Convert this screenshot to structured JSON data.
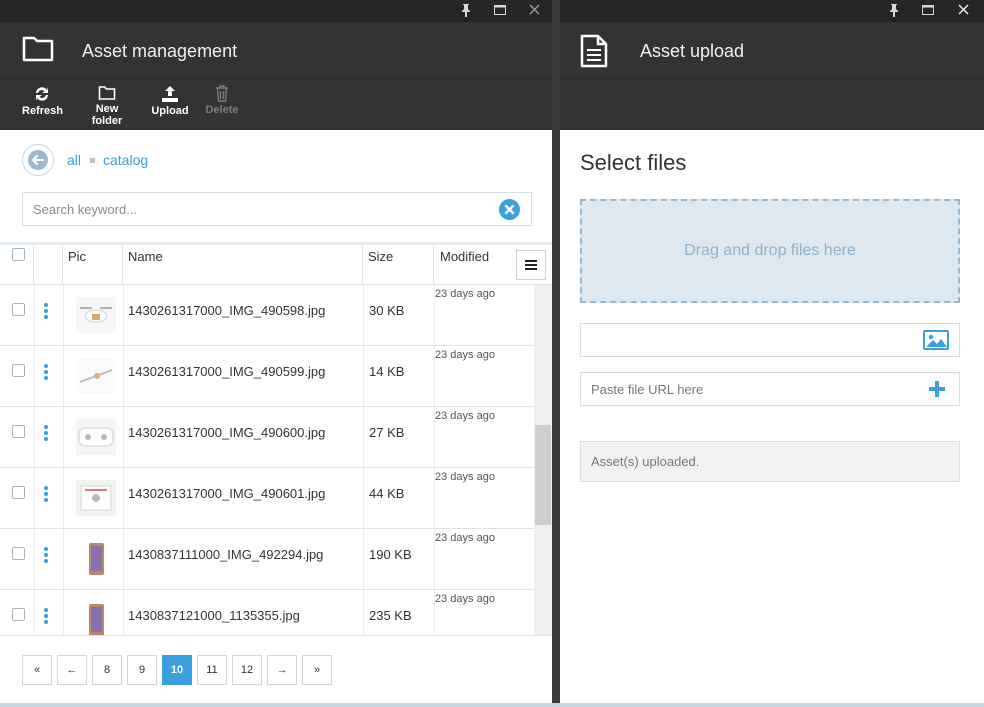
{
  "left_panel": {
    "title": "Asset management",
    "toolbar": {
      "refresh": "Refresh",
      "new_folder": "New folder",
      "upload": "Upload",
      "delete": "Delete"
    },
    "breadcrumb": [
      "all",
      "catalog"
    ],
    "search": {
      "placeholder": "Search keyword..."
    },
    "columns": [
      "Pic",
      "Name",
      "Size",
      "Modified"
    ],
    "rows": [
      {
        "name": "1430261317000_IMG_490598.jpg",
        "size": "30 KB",
        "modified": "23 days ago",
        "thumb": "drone-icon"
      },
      {
        "name": "1430261317000_IMG_490599.jpg",
        "size": "14 KB",
        "modified": "23 days ago",
        "thumb": "propeller-icon"
      },
      {
        "name": "1430261317000_IMG_490600.jpg",
        "size": "27 KB",
        "modified": "23 days ago",
        "thumb": "controller-icon"
      },
      {
        "name": "1430261317000_IMG_490601.jpg",
        "size": "44 KB",
        "modified": "23 days ago",
        "thumb": "product-sheet-icon"
      },
      {
        "name": "1430837111000_IMG_492294.jpg",
        "size": "190 KB",
        "modified": "23 days ago",
        "thumb": "phone-icon"
      },
      {
        "name": "1430837121000_1135355.jpg",
        "size": "235 KB",
        "modified": "23 days ago",
        "thumb": "phone-icon"
      }
    ],
    "pager": {
      "first": "«",
      "prev": "←",
      "pages": [
        "8",
        "9",
        "10",
        "11",
        "12"
      ],
      "current": "10",
      "next": "→",
      "last": "»"
    }
  },
  "right_panel": {
    "title": "Asset upload",
    "select_title": "Select files",
    "dropzone": "Drag and drop files here",
    "url_placeholder": "Paste file URL here",
    "status": "Asset(s) uploaded."
  },
  "colors": {
    "accent": "#3aa0dc",
    "header_bg": "#333333",
    "titlebar_bg": "#262626"
  }
}
